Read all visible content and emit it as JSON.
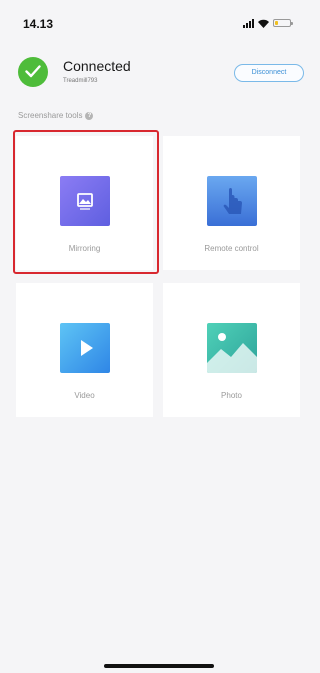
{
  "status_bar": {
    "time": "14.13",
    "battery_color": "#f0c020",
    "battery_level": 0.2
  },
  "connection": {
    "status": "Connected",
    "device_name": "Treadmill793",
    "disconnect_label": "Disconnect",
    "status_color": "#4ebc3a"
  },
  "tools": {
    "section_title": "Screenshare tools",
    "help_icon": "?",
    "items": [
      {
        "label": "Mirroring",
        "icon": "mirroring-icon",
        "selected": true
      },
      {
        "label": "Remote control",
        "icon": "touch-icon",
        "selected": false
      },
      {
        "label": "Video",
        "icon": "play-icon",
        "selected": false
      },
      {
        "label": "Photo",
        "icon": "photo-icon",
        "selected": false
      }
    ]
  },
  "colors": {
    "accent_blue": "#3a8fd6",
    "highlight_red": "#d8282f"
  }
}
